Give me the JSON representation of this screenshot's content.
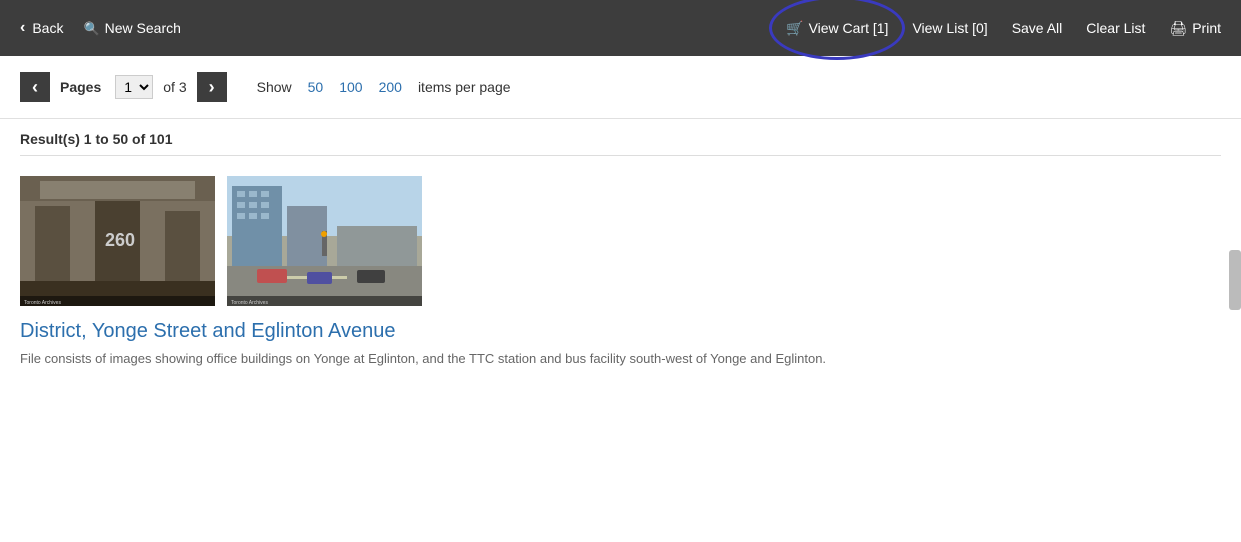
{
  "toolbar": {
    "back_label": "Back",
    "new_search_label": "New Search",
    "view_cart_label": "View Cart [1]",
    "view_list_label": "View List [0]",
    "save_all_label": "Save All",
    "clear_list_label": "Clear List",
    "print_label": "Print"
  },
  "pagination": {
    "pages_label": "Pages",
    "current_page": "1",
    "of_pages": "of 3",
    "show_label": "Show",
    "per_page_options": [
      "50",
      "100",
      "200"
    ],
    "items_per_page_label": "items per page"
  },
  "results": {
    "summary": "Result(s) 1 to 50 of 101",
    "items": [
      {
        "title": "District, Yonge Street and Eglinton Avenue",
        "description": "File consists of images showing office buildings on Yonge at Eglinton, and the TTC station and bus facility south-west of Yonge and Eglinton."
      }
    ]
  }
}
